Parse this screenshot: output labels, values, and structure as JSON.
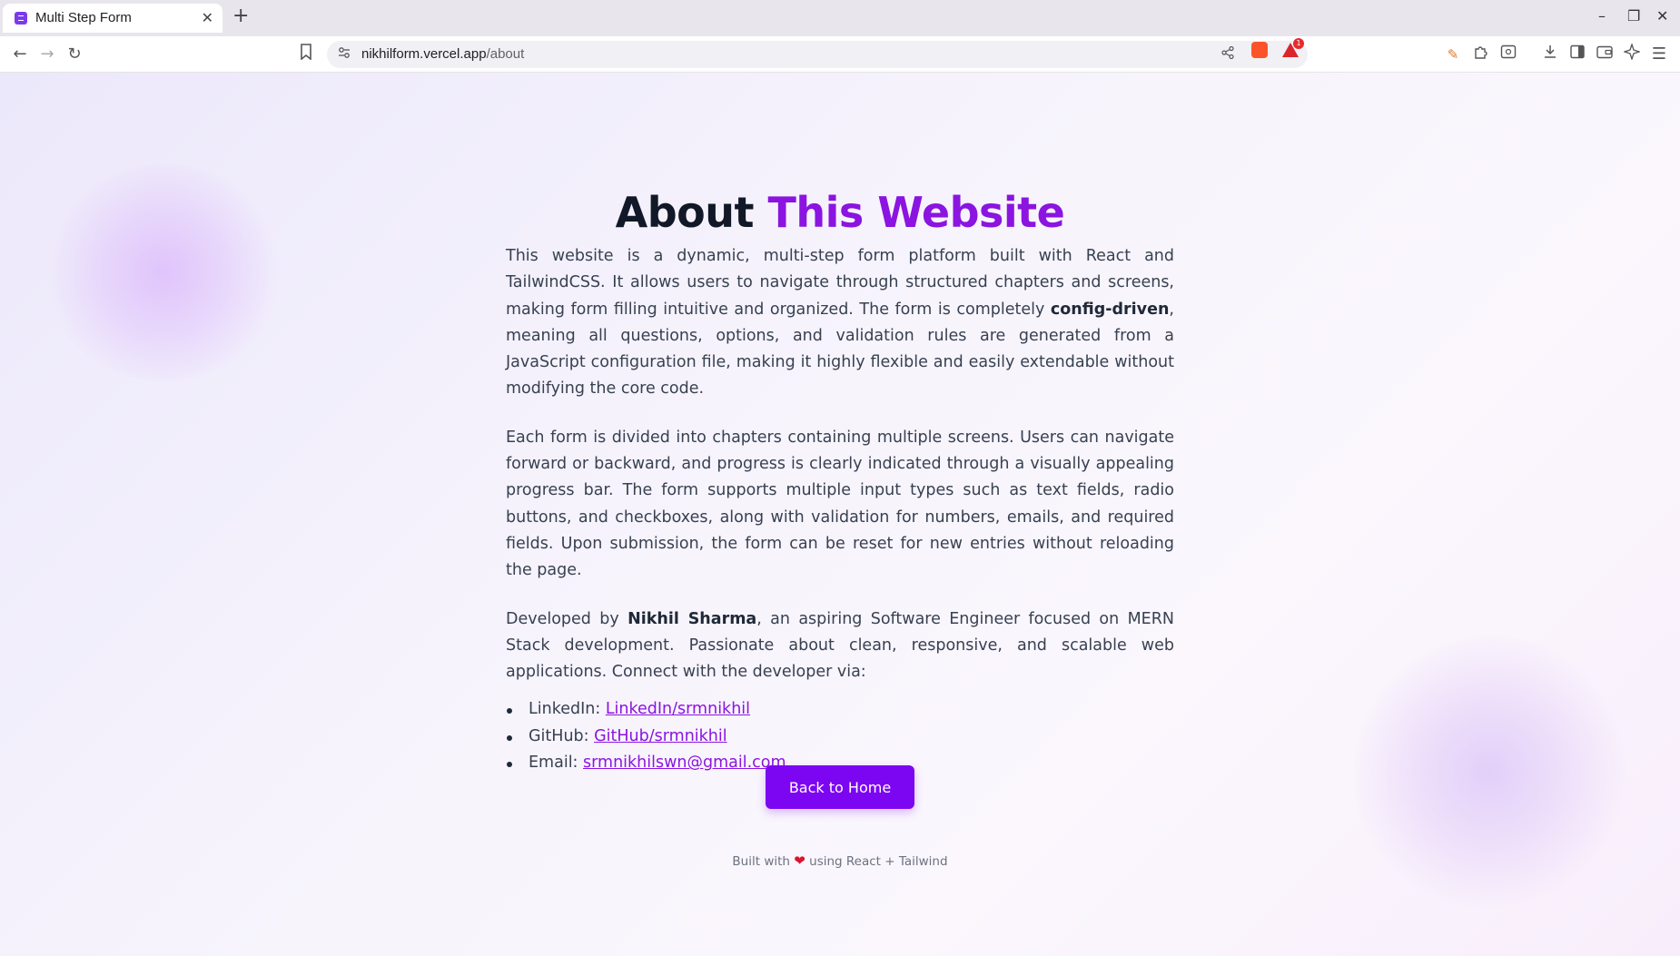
{
  "browser": {
    "tab_title": "Multi Step Form",
    "tab_close": "✕",
    "new_tab": "+",
    "url_host": "nikhilform.vercel.app",
    "url_path": "/about",
    "alert_count": "1",
    "icons": {
      "back": "←",
      "forward": "→",
      "reload": "↻",
      "bookmark": "🔖",
      "share": "⇪",
      "extensions": "⚙",
      "menu": "☰",
      "minimize": "–",
      "maximize": "❐",
      "close": "✕"
    }
  },
  "page": {
    "heading_main": "About ",
    "heading_accent": "This Website",
    "para1_pre": "This website is a dynamic, multi-step form platform built with React and TailwindCSS. It allows users to navigate through structured chapters and screens, making form filling intuitive and organized. The form is completely ",
    "para1_bold": "config-driven",
    "para1_post": ", meaning all questions, options, and validation rules are generated from a JavaScript configuration file, making it highly flexible and easily extendable without modifying the core code.",
    "para2": "Each form is divided into chapters containing multiple screens. Users can navigate forward or backward, and progress is clearly indicated through a visually appealing progress bar. The form supports multiple input types such as text fields, radio buttons, and checkboxes, along with validation for numbers, emails, and required fields. Upon submission, the form can be reset for new entries without reloading the page.",
    "para3_pre": "Developed by ",
    "para3_bold": "Nikhil Sharma",
    "para3_post": ", an aspiring Software Engineer focused on MERN Stack development. Passionate about clean, responsive, and scalable web applications. Connect with the developer via:",
    "links": [
      {
        "label": "LinkedIn: ",
        "text": "LinkedIn/srmnikhil"
      },
      {
        "label": "GitHub: ",
        "text": "GitHub/srmnikhil"
      },
      {
        "label": "Email: ",
        "text": "srmnikhilswn@gmail.com"
      }
    ],
    "button_label": "Back to Home",
    "footer_pre": "Built with ",
    "footer_heart": "❤",
    "footer_post": " using React + Tailwind"
  },
  "colors": {
    "accent": "#8b14e0",
    "button": "#7c05f2",
    "heading": "#111827",
    "body_text": "#374151"
  }
}
